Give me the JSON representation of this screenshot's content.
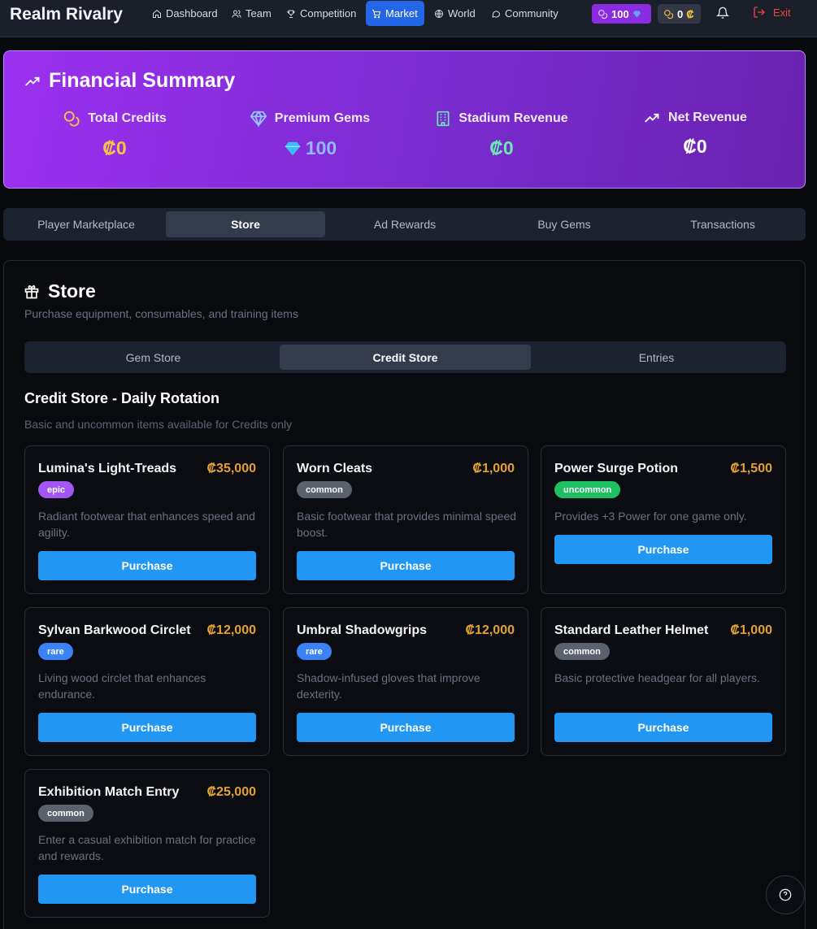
{
  "nav": {
    "brand": "Realm Rivalry",
    "items": [
      {
        "label": "Dashboard",
        "icon": "home-icon"
      },
      {
        "label": "Team",
        "icon": "users-icon"
      },
      {
        "label": "Competition",
        "icon": "trophy-icon"
      },
      {
        "label": "Market",
        "icon": "cart-icon"
      },
      {
        "label": "World",
        "icon": "globe-icon"
      },
      {
        "label": "Community",
        "icon": "chat-icon"
      }
    ],
    "active": "Market",
    "gems": "100",
    "credits": "0",
    "credit_symbol": "₡",
    "exit": "Exit"
  },
  "financial": {
    "title": "Financial Summary",
    "stats": [
      {
        "label": "Total Credits",
        "value": "₡0",
        "color": "#f5c542"
      },
      {
        "label": "Premium Gems",
        "value": "100",
        "color": "#8fb8ff"
      },
      {
        "label": "Stadium Revenue",
        "value": "₡0",
        "color": "#6ee7b7"
      },
      {
        "label": "Net Revenue",
        "value": "₡0",
        "color": "#ffffff"
      }
    ]
  },
  "tabs": [
    "Player Marketplace",
    "Store",
    "Ad Rewards",
    "Buy Gems",
    "Transactions"
  ],
  "store": {
    "title": "Store",
    "subtitle": "Purchase equipment, consumables, and training items",
    "subtabs": [
      "Gem Store",
      "Credit Store",
      "Entries"
    ],
    "section_title": "Credit Store - Daily Rotation",
    "section_subtitle": "Basic and uncommon items available for Credits only",
    "purchase_label": "Purchase",
    "items": [
      {
        "name": "Lumina's Light-Treads",
        "price": "₡35,000",
        "rarity": "epic",
        "desc": "Radiant footwear that enhances speed and agility."
      },
      {
        "name": "Worn Cleats",
        "price": "₡1,000",
        "rarity": "common",
        "desc": "Basic footwear that provides minimal speed boost."
      },
      {
        "name": "Power Surge Potion",
        "price": "₡1,500",
        "rarity": "uncommon",
        "desc": "Provides +3 Power for one game only."
      },
      {
        "name": "Sylvan Barkwood Circlet",
        "price": "₡12,000",
        "rarity": "rare",
        "desc": "Living wood circlet that enhances endurance."
      },
      {
        "name": "Umbral Shadowgrips",
        "price": "₡12,000",
        "rarity": "rare",
        "desc": "Shadow-infused gloves that improve dexterity."
      },
      {
        "name": "Standard Leather Helmet",
        "price": "₡1,000",
        "rarity": "common",
        "desc": "Basic protective headgear for all players."
      },
      {
        "name": "Exhibition Match Entry",
        "price": "₡25,000",
        "rarity": "common",
        "desc": "Enter a casual exhibition match for practice and rewards."
      }
    ]
  },
  "colors": {
    "accent": "#2466e8",
    "purchase": "#2196f3",
    "price": "#e2a133",
    "gem_pill": "#8b2be2",
    "exit": "#ef4444"
  }
}
